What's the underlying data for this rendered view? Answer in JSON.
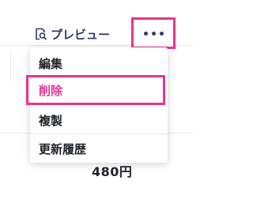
{
  "header": {
    "preview_label": "プレビュー",
    "preview_icon": "preview-search-icon",
    "more_icon": "more-dots-icon"
  },
  "menu": {
    "items": [
      {
        "label": "編集",
        "key": "edit"
      },
      {
        "label": "削除",
        "key": "delete",
        "color": "#e8348f",
        "highlighted": true
      },
      {
        "label": "複製",
        "key": "duplicate"
      },
      {
        "label": "更新履歴",
        "key": "history"
      }
    ]
  },
  "background": {
    "price_text": "480円"
  },
  "colors": {
    "accent": "#e8348f",
    "navy": "#2f3b6a",
    "text": "#1f2329"
  }
}
